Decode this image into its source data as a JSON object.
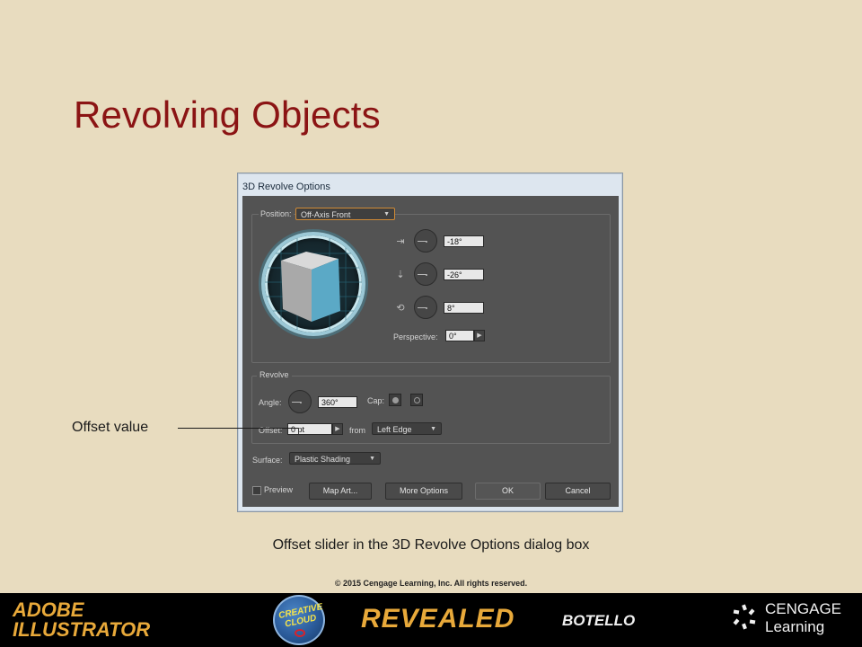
{
  "slide": {
    "title": "Revolving Objects",
    "callout": "Offset value",
    "caption": "Offset slider in the 3D Revolve Options dialog box",
    "copyright": "© 2015 Cengage Learning, Inc. All rights reserved."
  },
  "dialog": {
    "title": "3D Revolve Options",
    "position": {
      "label": "Position:",
      "value": "Off-Axis Front",
      "x_rotation": "-18°",
      "y_rotation": "-26°",
      "z_rotation": "8°",
      "perspective_label": "Perspective:",
      "perspective_value": "0°"
    },
    "revolve": {
      "group_label": "Revolve",
      "angle_label": "Angle:",
      "angle_value": "360°",
      "cap_label": "Cap:",
      "offset_label": "Offset:",
      "offset_value": "0 pt",
      "from_label": "from",
      "from_value": "Left Edge"
    },
    "surface": {
      "label": "Surface:",
      "value": "Plastic Shading"
    },
    "buttons": {
      "preview": "Preview",
      "map_art": "Map Art...",
      "more_options": "More Options",
      "ok": "OK",
      "cancel": "Cancel"
    },
    "accent_color": "#d08a36",
    "cube_face_color": "#5ba9c6"
  },
  "footer": {
    "adobe_line1": "ADOBE",
    "adobe_line2": "ILLUSTRATOR",
    "cc_line1": "CREATIVE",
    "cc_line2": "CLOUD",
    "revealed": "REVEALED",
    "author": "BOTELLO",
    "publisher_line1": "CENGAGE",
    "publisher_line2": "Learning"
  }
}
